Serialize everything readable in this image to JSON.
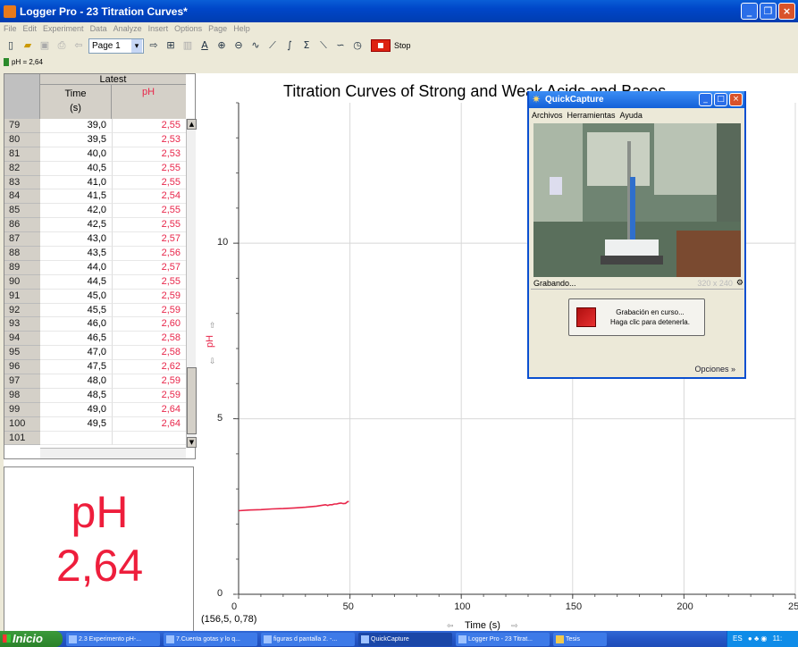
{
  "window": {
    "title": "Logger Pro - 23 Titration Curves*"
  },
  "menu": [
    "File",
    "Edit",
    "Experiment",
    "Data",
    "Analyze",
    "Insert",
    "Options",
    "Page",
    "Help"
  ],
  "toolbar": {
    "page_label": "Page 1",
    "stop_label": "Stop"
  },
  "status": {
    "reading": "pH = 2,64"
  },
  "table": {
    "group_header": "Latest",
    "col_time": "Time",
    "col_time_unit": "(s)",
    "col_ph": "pH",
    "rows": [
      {
        "n": "79",
        "t": "39,0",
        "p": "2,55"
      },
      {
        "n": "80",
        "t": "39,5",
        "p": "2,53"
      },
      {
        "n": "81",
        "t": "40,0",
        "p": "2,53"
      },
      {
        "n": "82",
        "t": "40,5",
        "p": "2,55"
      },
      {
        "n": "83",
        "t": "41,0",
        "p": "2,55"
      },
      {
        "n": "84",
        "t": "41,5",
        "p": "2,54"
      },
      {
        "n": "85",
        "t": "42,0",
        "p": "2,55"
      },
      {
        "n": "86",
        "t": "42,5",
        "p": "2,55"
      },
      {
        "n": "87",
        "t": "43,0",
        "p": "2,57"
      },
      {
        "n": "88",
        "t": "43,5",
        "p": "2,56"
      },
      {
        "n": "89",
        "t": "44,0",
        "p": "2,57"
      },
      {
        "n": "90",
        "t": "44,5",
        "p": "2,55"
      },
      {
        "n": "91",
        "t": "45,0",
        "p": "2,59"
      },
      {
        "n": "92",
        "t": "45,5",
        "p": "2,59"
      },
      {
        "n": "93",
        "t": "46,0",
        "p": "2,60"
      },
      {
        "n": "94",
        "t": "46,5",
        "p": "2,58"
      },
      {
        "n": "95",
        "t": "47,0",
        "p": "2,58"
      },
      {
        "n": "96",
        "t": "47,5",
        "p": "2,62"
      },
      {
        "n": "97",
        "t": "48,0",
        "p": "2,59"
      },
      {
        "n": "98",
        "t": "48,5",
        "p": "2,59"
      },
      {
        "n": "99",
        "t": "49,0",
        "p": "2,64"
      },
      {
        "n": "100",
        "t": "49,5",
        "p": "2,64"
      },
      {
        "n": "101",
        "t": "",
        "p": ""
      }
    ]
  },
  "meter": {
    "label": "pH",
    "value": "2,64"
  },
  "graph": {
    "title": "Titration Curves of Strong and Weak Acids and Bases",
    "coord_readout": "(156,5, 0,78)",
    "x_label": "Time (s)",
    "y_label": "pH"
  },
  "chart_data": {
    "type": "line",
    "title": "Titration Curves of Strong and Weak Acids and Bases",
    "xlabel": "Time (s)",
    "ylabel": "pH",
    "xlim": [
      0,
      250
    ],
    "ylim": [
      0,
      14
    ],
    "x_ticks": [
      0,
      50,
      100,
      150,
      200,
      250
    ],
    "y_ticks": [
      0,
      5,
      10
    ],
    "grid": true,
    "color": "#e8264a",
    "series": [
      {
        "x": [
          0,
          5,
          10,
          15,
          20,
          25,
          30,
          35,
          39,
          40,
          41,
          42,
          43,
          44,
          45,
          46,
          47,
          48,
          49,
          49.5
        ],
        "y": [
          2.38,
          2.4,
          2.41,
          2.43,
          2.44,
          2.46,
          2.48,
          2.51,
          2.55,
          2.53,
          2.55,
          2.55,
          2.57,
          2.57,
          2.59,
          2.6,
          2.58,
          2.59,
          2.64,
          2.64
        ]
      }
    ]
  },
  "quickcapture": {
    "title": "QuickCapture",
    "menu": [
      "Archivos",
      "Herramientas",
      "Ayuda"
    ],
    "status": "Grabando...",
    "resolution": "320 x 240",
    "rec_line1": "Grabación en curso...",
    "rec_line2": "Haga clic para detenerla.",
    "options": "Opciones"
  },
  "taskbar": {
    "start": "Inicio",
    "tasks": [
      "2.3 Experimento pH-...",
      "7.Cuenta gotas y lo q...",
      "figuras d pantalla 2. -...",
      "QuickCapture",
      "Logger Pro - 23 Titrat...",
      "Tesis"
    ],
    "lang": "ES",
    "clock": "11:"
  }
}
